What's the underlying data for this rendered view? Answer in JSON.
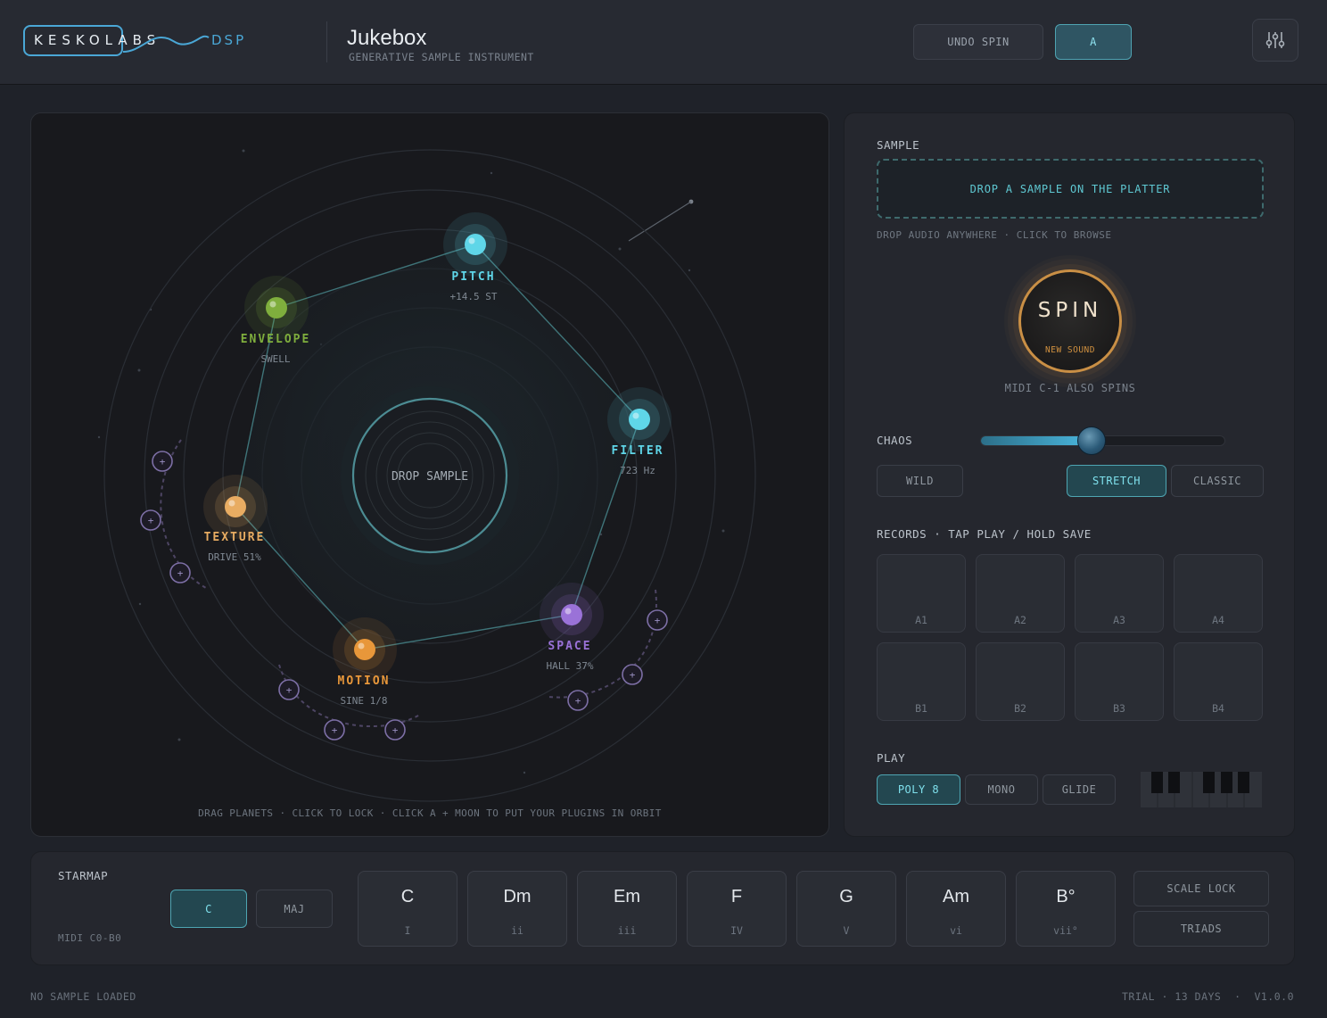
{
  "header": {
    "logo_main": "KESKOLABS",
    "logo_suffix": "DSP",
    "title": "Jukebox",
    "subtitle": "GENERATIVE SAMPLE INSTRUMENT",
    "undo_label": "UNDO SPIN",
    "ab_label": "A"
  },
  "orbit": {
    "center_label": "DROP SAMPLE",
    "hint": "DRAG PLANETS · CLICK TO LOCK · CLICK A + MOON TO PUT YOUR PLUGINS IN ORBIT",
    "moon_symbol": "+",
    "planets": [
      {
        "name": "PITCH",
        "value": "+14.5 ST",
        "color": "#5fd6e8"
      },
      {
        "name": "ENVELOPE",
        "value": "SWELL",
        "color": "#7fae3d"
      },
      {
        "name": "FILTER",
        "value": "723 Hz",
        "color": "#5fd6e8"
      },
      {
        "name": "TEXTURE",
        "value": "DRIVE 51%",
        "color": "#e8ac62"
      },
      {
        "name": "MOTION",
        "value": "SINE 1/8",
        "color": "#e8973a"
      },
      {
        "name": "SPACE",
        "value": "HALL 37%",
        "color": "#9a72d8"
      }
    ]
  },
  "side": {
    "sample_label": "SAMPLE",
    "drop_text": "DROP A SAMPLE ON THE PLATTER",
    "drop_hint": "DROP AUDIO ANYWHERE · CLICK TO BROWSE",
    "spin_label": "SPIN",
    "spin_sub": "NEW SOUND",
    "midi_hint": "MIDI C-1 ALSO SPINS",
    "chaos_label": "CHAOS",
    "chaos_value": 0.45,
    "modes": {
      "wild": "WILD",
      "stretch": "STRETCH",
      "classic": "CLASSIC"
    },
    "records_label": "RECORDS · TAP PLAY / HOLD SAVE",
    "records": [
      "A1",
      "A2",
      "A3",
      "A4",
      "B1",
      "B2",
      "B3",
      "B4"
    ],
    "play_label": "PLAY",
    "play_modes": {
      "poly": "POLY 8",
      "mono": "MONO",
      "glide": "GLIDE"
    }
  },
  "starmap": {
    "label": "STARMAP",
    "midi_range": "MIDI C0-B0",
    "key": "C",
    "scale": "MAJ",
    "chords": [
      {
        "name": "C",
        "degree": "I"
      },
      {
        "name": "Dm",
        "degree": "ii"
      },
      {
        "name": "Em",
        "degree": "iii"
      },
      {
        "name": "F",
        "degree": "IV"
      },
      {
        "name": "G",
        "degree": "V"
      },
      {
        "name": "Am",
        "degree": "vi"
      },
      {
        "name": "B°",
        "degree": "vii°"
      }
    ],
    "scale_lock": "SCALE LOCK",
    "triads": "TRIADS"
  },
  "footer": {
    "status": "NO SAMPLE LOADED",
    "trial": "TRIAL · 13 DAYS  ·  V1.0.0"
  },
  "colors": {
    "accent": "#4fa3b2",
    "spin": "#c98f45",
    "background": "#1f2229"
  }
}
